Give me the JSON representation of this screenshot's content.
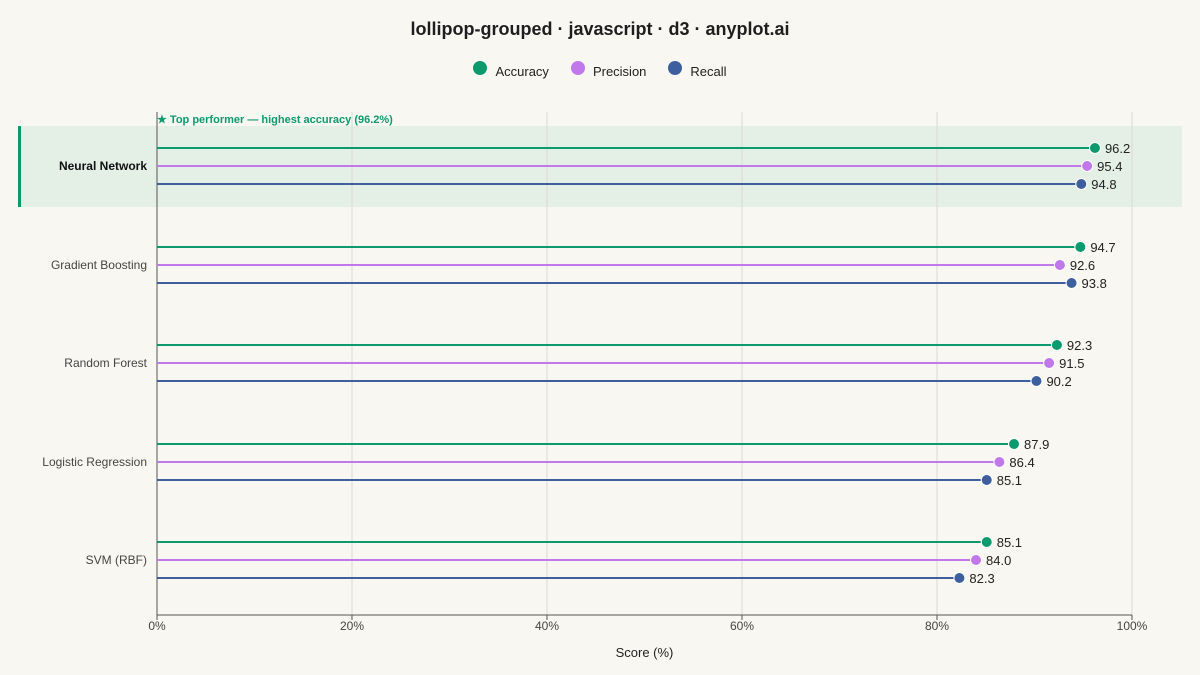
{
  "title": "lollipop-grouped · javascript · d3 · anyplot.ai",
  "legend": [
    {
      "name": "Accuracy",
      "color": "#0b9a6e"
    },
    {
      "name": "Precision",
      "color": "#c178ea"
    },
    {
      "name": "Recall",
      "color": "#3e5f9e"
    }
  ],
  "annotation": "★ Top performer — highest accuracy (96.2%)",
  "highlight_color": "#0b9a6e",
  "chart_data": {
    "type": "lollipop-grouped",
    "categories": [
      "Neural Network",
      "Gradient Boosting",
      "Random Forest",
      "Logistic Regression",
      "SVM (RBF)"
    ],
    "highlighted_category": "Neural Network",
    "series": [
      {
        "name": "Accuracy",
        "values": [
          96.2,
          94.7,
          92.3,
          87.9,
          85.1
        ]
      },
      {
        "name": "Precision",
        "values": [
          95.4,
          92.6,
          91.5,
          86.4,
          84.0
        ]
      },
      {
        "name": "Recall",
        "values": [
          94.8,
          93.8,
          90.2,
          85.1,
          82.3
        ]
      }
    ],
    "xlabel": "Score (%)",
    "ylabel": "",
    "xlim": [
      0,
      100
    ],
    "xticks": [
      "0%",
      "20%",
      "40%",
      "60%",
      "80%",
      "100%"
    ],
    "grid": true,
    "legend_position": "top-center"
  }
}
